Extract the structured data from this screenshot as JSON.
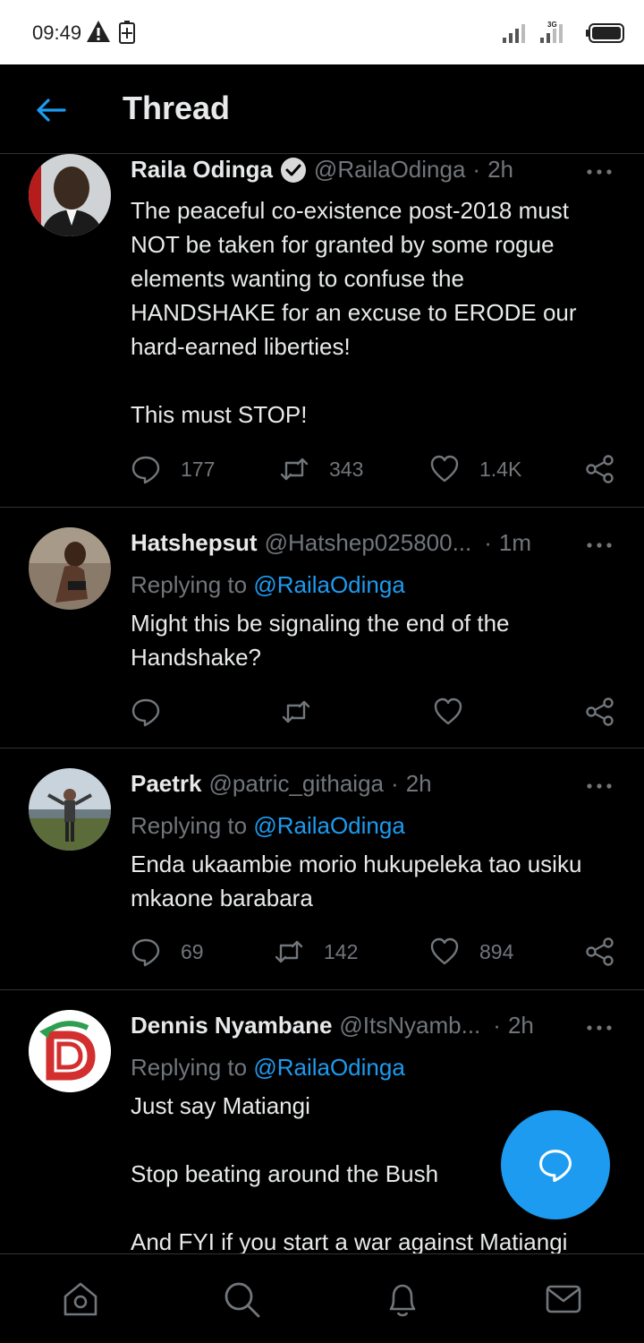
{
  "status_bar": {
    "time": "09:49",
    "network": "3G"
  },
  "header": {
    "title": "Thread"
  },
  "tweets": [
    {
      "name": "Raila Odinga",
      "handle": "@RailaOdinga",
      "time": "2h",
      "verified": true,
      "text": "The peaceful co-existence post-2018 must\nNOT be taken for granted by some rogue\nelements wanting to confuse the\nHANDSHAKE for an excuse to ERODE our\nhard-earned liberties!\n\nThis must STOP!",
      "replies": "177",
      "retweets": "343",
      "likes": "1.4K"
    },
    {
      "name": "Hatshepsut",
      "handle": "@Hatshep025800...",
      "time": "1m",
      "replying_label": "Replying to",
      "replying_to": "@RailaOdinga",
      "text": "Might this be signaling the end of the\nHandshake?",
      "replies": "",
      "retweets": "",
      "likes": ""
    },
    {
      "name": "Paetrk",
      "handle": "@patric_githaiga",
      "time": "2h",
      "replying_label": "Replying to",
      "replying_to": "@RailaOdinga",
      "text": "Enda ukaambie morio hukupeleka tao usiku\nmkaone barabara",
      "replies": "69",
      "retweets": "142",
      "likes": "894"
    },
    {
      "name": "Dennis Nyambane",
      "handle": "@ItsNyamb...",
      "time": "2h",
      "replying_label": "Replying to",
      "replying_to": "@RailaOdinga",
      "text": "Just say Matiangi\n\nStop beating around the Bush\n\nAnd FYI if you start a war against Matiangi"
    }
  ],
  "icons": {
    "back": "arrow-left-icon",
    "more": "more-dots-icon",
    "reply": "reply-icon",
    "retweet": "retweet-icon",
    "like": "heart-icon",
    "share": "share-icon",
    "compose": "compose-reply-icon",
    "home": "home-icon",
    "search": "search-icon",
    "notifications": "bell-icon",
    "messages": "mail-icon"
  },
  "colors": {
    "background": "#000000",
    "accent": "#1d9bf0",
    "text_primary": "#e7e9ea",
    "text_secondary": "#71767b",
    "divider": "#2f3336"
  }
}
